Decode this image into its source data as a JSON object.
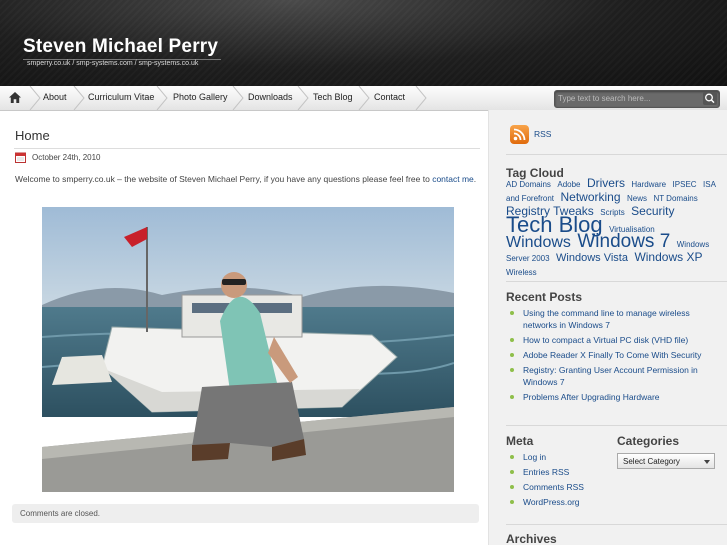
{
  "site": {
    "title": "Steven Michael Perry",
    "description": "smperry.co.uk / smp-systems.com / smp-systems.co.uk"
  },
  "nav": {
    "items": [
      "About",
      "Curriculum Vitae",
      "Photo Gallery",
      "Downloads",
      "Tech Blog",
      "Contact"
    ]
  },
  "search": {
    "placeholder": "Type text to search here..."
  },
  "post": {
    "title": "Home",
    "date": "October 24th, 2010",
    "body_text": "Welcome to smperry.co.uk – the website of Steven Michael Perry, if you have any questions please feel free to",
    "body_link": "contact me",
    "body_end": ".",
    "comments_closed": "Comments are closed."
  },
  "sidebar": {
    "rss_label": "RSS",
    "tag_cloud_title": "Tag Cloud",
    "tags": [
      {
        "label": "AD Domains",
        "size": 8
      },
      {
        "label": "Adobe",
        "size": 8
      },
      {
        "label": "Drivers",
        "size": 12
      },
      {
        "label": "Hardware",
        "size": 8
      },
      {
        "label": "IPSEC",
        "size": 8
      },
      {
        "label": "ISA and Forefront",
        "size": 8
      },
      {
        "label": "Networking",
        "size": 12
      },
      {
        "label": "News",
        "size": 8
      },
      {
        "label": "NT Domains",
        "size": 8
      },
      {
        "label": "Registry Tweaks",
        "size": 12
      },
      {
        "label": "Scripts",
        "size": 8
      },
      {
        "label": "Security",
        "size": 12
      },
      {
        "label": "Tech Blog",
        "size": 22
      },
      {
        "label": "Virtualisation",
        "size": 8
      },
      {
        "label": "Windows",
        "size": 16
      },
      {
        "label": "Windows 7",
        "size": 19
      },
      {
        "label": "Windows Server 2003",
        "size": 8
      },
      {
        "label": "Windows Vista",
        "size": 11
      },
      {
        "label": "Windows XP",
        "size": 12
      },
      {
        "label": "Wireless",
        "size": 8
      }
    ],
    "recent_posts_title": "Recent Posts",
    "recent_posts": [
      "Using the command line to manage wireless networks in Windows 7",
      "How to compact a Virtual PC disk (VHD file)",
      "Adobe Reader X Finally To Come With Security",
      "Registry: Granting User Account Permission in Windows 7",
      "Problems After Upgrading Hardware"
    ],
    "meta_title": "Meta",
    "meta_items": [
      "Log in",
      "Entries RSS",
      "Comments RSS",
      "WordPress.org"
    ],
    "categories_title": "Categories",
    "categories_selected": "Select Category",
    "archives_title": "Archives"
  },
  "colors": {
    "link": "#1a4c8a",
    "bullet": "#8fbf4a",
    "rss": "#f08a24",
    "header_bg": "#1e1e1e"
  }
}
